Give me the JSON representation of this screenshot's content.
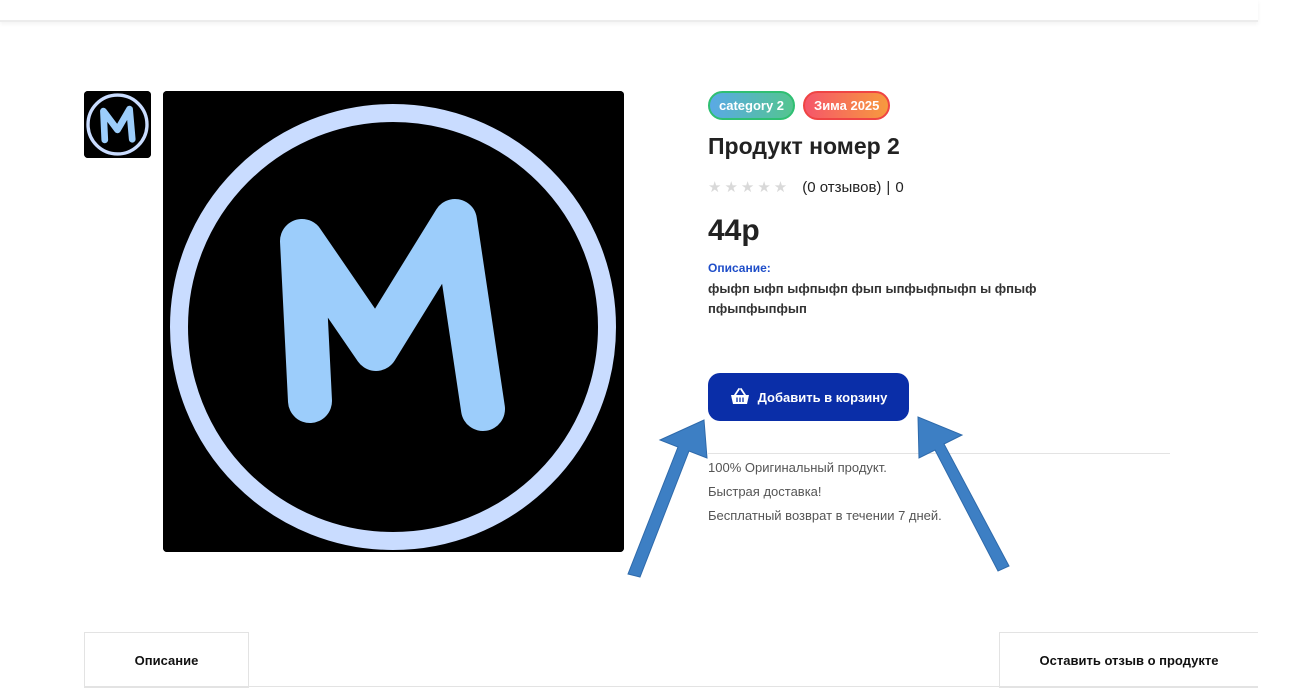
{
  "product": {
    "title": "Продукт номер 2",
    "badges": [
      {
        "label": "category 2"
      },
      {
        "label": "Зима 2025"
      }
    ],
    "rating": {
      "stars_filled": 0,
      "stars_total": 5,
      "reviews_text": "(0 отзывов)",
      "separator": "|",
      "count": "0"
    },
    "price": "44р",
    "description_label": "Описание:",
    "description_text": "фыфп ыфп ыфпыфп фып ыпфыфпыфп ы фпыф пфыпфыпфып",
    "add_to_cart_label": "Добавить в корзину",
    "features": [
      "100% Оригинальный продукт.",
      "Быстрая доставка!",
      "Бесплатный возврат в течении 7 дней."
    ],
    "logo_letter": "M"
  },
  "tabs": {
    "description": "Описание",
    "leave_review": "Оставить отзыв о продукте"
  },
  "colors": {
    "accent": "#0a2ea8",
    "logo_ring": "#c9dcff",
    "logo_letter": "#9ccdfb",
    "annotation_arrow": "#3d7fc4"
  }
}
